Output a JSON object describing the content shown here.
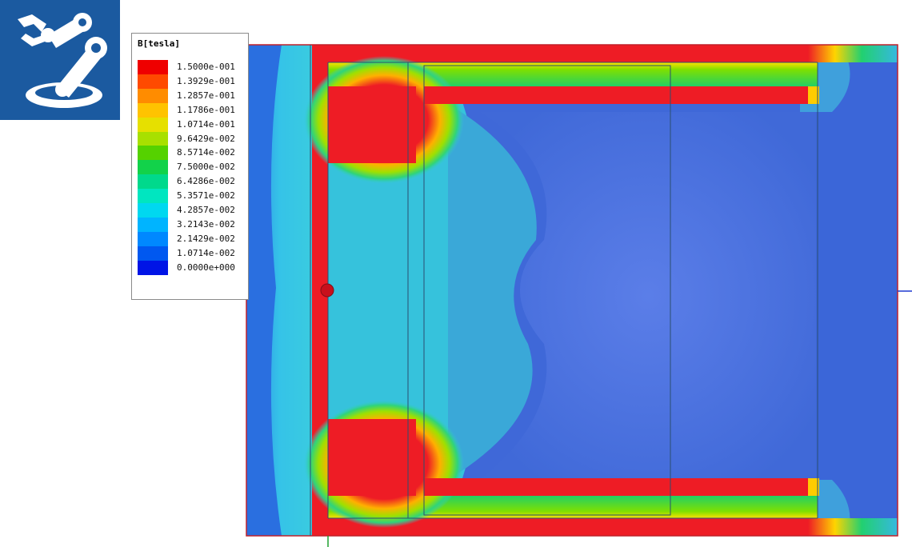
{
  "legend": {
    "title": "B[tesla]",
    "entries": [
      {
        "label": "1.5000e-001",
        "color": "#ef0000"
      },
      {
        "label": "1.3929e-001",
        "color": "#ff4a00"
      },
      {
        "label": "1.2857e-001",
        "color": "#ff8c00"
      },
      {
        "label": "1.1786e-001",
        "color": "#ffc300"
      },
      {
        "label": "1.0714e-001",
        "color": "#e6e000"
      },
      {
        "label": "9.6429e-002",
        "color": "#a8e000"
      },
      {
        "label": "8.5714e-002",
        "color": "#55d200"
      },
      {
        "label": "7.5000e-002",
        "color": "#12d24a"
      },
      {
        "label": "6.4286e-002",
        "color": "#00d98c"
      },
      {
        "label": "5.3571e-002",
        "color": "#00e6c0"
      },
      {
        "label": "4.2857e-002",
        "color": "#00d8f0"
      },
      {
        "label": "3.2143e-002",
        "color": "#00b4ff"
      },
      {
        "label": "2.1429e-002",
        "color": "#0088ff"
      },
      {
        "label": "1.0714e-002",
        "color": "#0058f0"
      },
      {
        "label": "0.0000e+000",
        "color": "#0014e6"
      }
    ]
  },
  "colors": {
    "high": "#ee1c25",
    "cyan": "#32c8ea",
    "teal": "#36b4c8",
    "low": "#3a63d6",
    "logo_bg": "#1b5aa0"
  },
  "icons": {
    "logo": "robot-arm-icon",
    "probe": "probe-marker-icon"
  }
}
